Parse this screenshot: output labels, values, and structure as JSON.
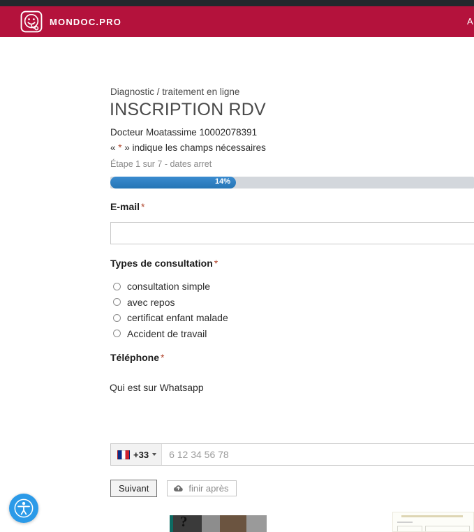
{
  "header": {
    "brand_name": "MONDOC.PRO",
    "brand_icon": "smiley-stethoscope-logo",
    "nav_partial_label": "A"
  },
  "form": {
    "eyebrow": "Diagnostic / traitement en ligne",
    "title": "INSCRIPTION RDV",
    "doctor_line": "Docteur Moatassime 10002078391",
    "required_note_prefix": "« ",
    "required_note_star": "*",
    "required_note_suffix": " » indique les champs nécessaires",
    "step_line": "Étape 1 sur 7 - dates arret",
    "progress": {
      "percent_label": "14%",
      "percent_value": 14,
      "fill_color": "#2a7ac0",
      "track_color": "#d3d7dc"
    },
    "email": {
      "label": "E-mail",
      "required_mark": "*",
      "value": "",
      "placeholder": ""
    },
    "consultation": {
      "label": "Types de consultation",
      "required_mark": "*",
      "options": [
        {
          "label": "consultation simple",
          "selected": false
        },
        {
          "label": "avec repos",
          "selected": false
        },
        {
          "label": "certificat enfant malade",
          "selected": false
        },
        {
          "label": "Accident de travail",
          "selected": false
        }
      ]
    },
    "telephone": {
      "label": "Téléphone",
      "required_mark": "*",
      "help_text": "Qui est sur Whatsapp",
      "country_flag": "flag-france",
      "dial_code": "+33",
      "value": "",
      "placeholder": "6 12 34 56 78"
    },
    "buttons": {
      "next_label": "Suivant",
      "finish_later_label": "finir après",
      "finish_later_icon": "cloud-save-icon"
    }
  },
  "widgets": {
    "accessibility_icon": "accessibility-person-icon",
    "accessibility_color": "#2b9ae8"
  },
  "bottom_media": {
    "photo_caption": "?",
    "photo_alt": "video-thumbnail",
    "document_alt": "document-thumbnail"
  }
}
